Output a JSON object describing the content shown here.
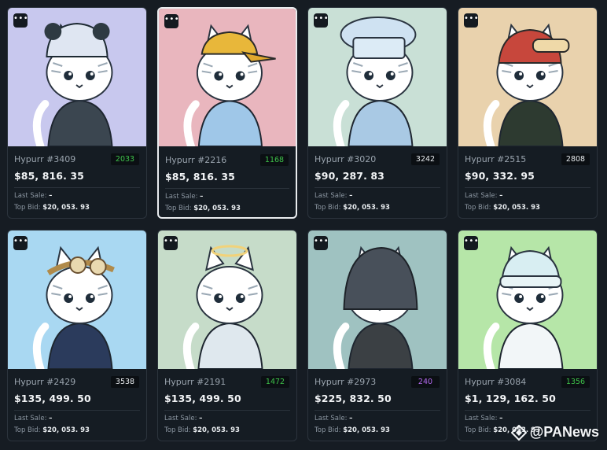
{
  "cards": [
    {
      "name": "Hypurr #3409",
      "price": "$85, 816. 35",
      "rank": "2033",
      "rank_color": "#3ec24a",
      "bg": "#c8c8ee",
      "outfit": "#3b4650",
      "hat": "panda",
      "last_sale_label": "Last Sale:",
      "last_sale": "–",
      "top_bid_label": "Top Bid:",
      "top_bid": "$20, 053. 93",
      "selected": false
    },
    {
      "name": "Hypurr #2216",
      "price": "$85, 816. 35",
      "rank": "1168",
      "rank_color": "#3ec24a",
      "bg": "#e9b6be",
      "outfit": "#9fc7e8",
      "hat": "cap",
      "last_sale_label": "Last Sale:",
      "last_sale": "–",
      "top_bid_label": "Top Bid:",
      "top_bid": "$20, 053. 93",
      "selected": true
    },
    {
      "name": "Hypurr #3020",
      "price": "$90, 287. 83",
      "rank": "3242",
      "rank_color": "#e8ecef",
      "bg": "#c9e0d6",
      "outfit": "#a9c9e4",
      "hat": "chef",
      "last_sale_label": "Last Sale:",
      "last_sale": "–",
      "top_bid_label": "Top Bid:",
      "top_bid": "$20, 053. 93",
      "selected": false
    },
    {
      "name": "Hypurr #2515",
      "price": "$90, 332. 95",
      "rank": "2808",
      "rank_color": "#e8ecef",
      "bg": "#e9d2ad",
      "outfit": "#2d3a30",
      "hat": "hood",
      "last_sale_label": "Last Sale:",
      "last_sale": "–",
      "top_bid_label": "Top Bid:",
      "top_bid": "$20, 053. 93",
      "selected": false
    },
    {
      "name": "Hypurr #2429",
      "price": "$135, 499. 50",
      "rank": "3538",
      "rank_color": "#e8ecef",
      "bg": "#a9d8f2",
      "outfit": "#2b3b5c",
      "hat": "goggles",
      "last_sale_label": "Last Sale:",
      "last_sale": "–",
      "top_bid_label": "Top Bid:",
      "top_bid": "$20, 053. 93",
      "selected": false
    },
    {
      "name": "Hypurr #2191",
      "price": "$135, 499. 50",
      "rank": "1472",
      "rank_color": "#3ec24a",
      "bg": "#c6dcc9",
      "outfit": "#dfe8ee",
      "hat": "halo",
      "last_sale_label": "Last Sale:",
      "last_sale": "–",
      "top_bid_label": "Top Bid:",
      "top_bid": "$20, 053. 93",
      "selected": false
    },
    {
      "name": "Hypurr #2973",
      "price": "$225, 832. 50",
      "rank": "240",
      "rank_color": "#b46af0",
      "bg": "#9fc2c1",
      "outfit": "#3b4044",
      "hat": "helmet",
      "last_sale_label": "Last Sale:",
      "last_sale": "–",
      "top_bid_label": "Top Bid:",
      "top_bid": "$20, 053. 93",
      "selected": false
    },
    {
      "name": "Hypurr #3084",
      "price": "$1, 129, 162. 50",
      "rank": "1356",
      "rank_color": "#3ec24a",
      "bg": "#b6e6a8",
      "outfit": "#f2f6f8",
      "hat": "beanie",
      "last_sale_label": "Last Sale:",
      "last_sale": "–",
      "top_bid_label": "Top Bid:",
      "top_bid": "$20, 053. 93",
      "selected": false
    }
  ],
  "more_label": "•••",
  "watermark": "@PANews"
}
